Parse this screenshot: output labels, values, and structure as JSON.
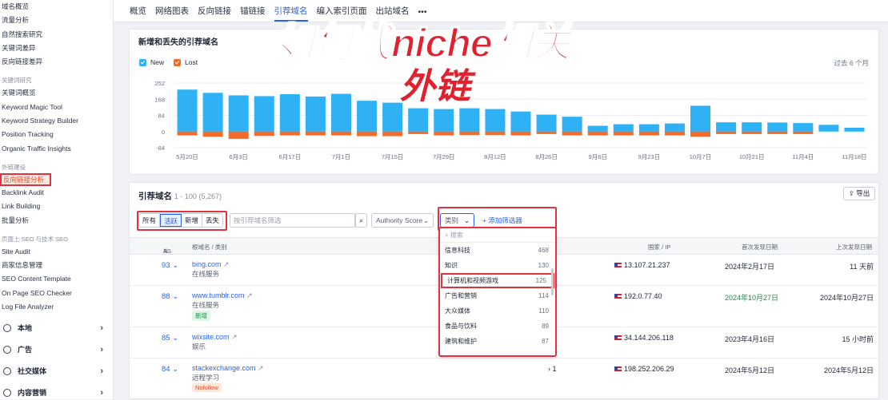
{
  "sidebar": {
    "top_items": [
      "域名概览",
      "流量分析",
      "自然搜索研究",
      "关键词差异",
      "反向链接差异"
    ],
    "section_keyword": "关键词研究",
    "keyword_items": [
      "关键词概览",
      "Keyword Magic Tool",
      "Keyword Strategy Builder",
      "Position Tracking",
      "Organic Traffic Insights"
    ],
    "section_link": "外链建设",
    "link_items": [
      "反向链接分析",
      "Backlink Audit",
      "Link Building",
      "批量分析"
    ],
    "section_seo": "页面上 SEO 与技术 SEO",
    "seo_items": [
      "Site Audit",
      "商家信息管理",
      "SEO Content Template",
      "On Page SEO Checker",
      "Log File Analyzer"
    ],
    "groups": [
      {
        "label": "本地",
        "icon": "location-icon"
      },
      {
        "label": "广告",
        "icon": "target-icon"
      },
      {
        "label": "社交媒体",
        "icon": "chat-icon"
      },
      {
        "label": "内容营销",
        "icon": "edit-icon"
      }
    ]
  },
  "topnav": {
    "tabs": [
      "概览",
      "网络图表",
      "反向链接",
      "锚链接",
      "引荐域名",
      "编入索引页面",
      "出站域名",
      "•••"
    ],
    "selected_index": 4
  },
  "chart_card": {
    "title": "新增和丢失的引荐域名",
    "legend_new": "New",
    "legend_lost": "Lost",
    "period": "过去 6 个月"
  },
  "chart_data": {
    "type": "bar",
    "series": [
      {
        "name": "New",
        "color": "#2fb2f5",
        "values": [
          218,
          201,
          188,
          184,
          194,
          182,
          196,
          160,
          150,
          121,
          117,
          121,
          117,
          104,
          88,
          77,
          30,
          38,
          38,
          42,
          134,
          48,
          48,
          47,
          44,
          35,
          20
        ]
      },
      {
        "name": "Lost",
        "color": "#f26b2b",
        "values": [
          -20,
          -27,
          -38,
          -23,
          -20,
          -20,
          -20,
          -24,
          -24,
          -13,
          -20,
          -18,
          -18,
          -20,
          -13,
          -20,
          -20,
          -20,
          -20,
          -20,
          -27,
          -13,
          -13,
          -13,
          -13,
          0,
          0
        ]
      }
    ],
    "x_tick_labels": [
      "5月20日",
      "6月3日",
      "6月17日",
      "7月1日",
      "7月15日",
      "7月29日",
      "8月12日",
      "8月26日",
      "9月6日",
      "9月23日",
      "10月7日",
      "10月21日",
      "11月4日",
      "11月18日"
    ],
    "y_ticks": [
      252,
      168,
      84,
      0,
      -84
    ],
    "ylim": [
      -84,
      252
    ]
  },
  "table_card": {
    "title": "引荐域名",
    "count": "1 - 100 (5,267)",
    "export_label": "导出",
    "segments": [
      "所有",
      "活跃",
      "新增",
      "丢失"
    ],
    "active_segment": 1,
    "search_placeholder": "按引荐域名筛选",
    "authority_label": "Authority Score",
    "category_label": "类别",
    "add_filter": "添加筛选器",
    "headers": {
      "as": "AS",
      "domain": "根域名 / 类别",
      "country": "国家 / IP",
      "first": "首次发现日期",
      "last": "上次发现日期"
    },
    "rows": [
      {
        "as": "93",
        "domain": "bing.com",
        "category": "在线服务",
        "badge": "",
        "links": "",
        "ip": "13.107.21.237",
        "first": "2024年2月17日",
        "last": "11 天前",
        "first_green": false
      },
      {
        "as": "88",
        "domain": "www.tumblr.com",
        "category": "在线服务",
        "badge": "新增",
        "links": "",
        "ip": "192.0.77.40",
        "first": "2024年10月27日",
        "last": "2024年10月27日",
        "first_green": true
      },
      {
        "as": "85",
        "domain": "wixsite.com",
        "category": "娱乐",
        "badge": "",
        "links": "",
        "ip": "34.144.206.118",
        "first": "2023年4月16日",
        "last": "15 小时前",
        "first_green": false
      },
      {
        "as": "84",
        "domain": "stackexchange.com",
        "category": "远程学习",
        "badge": "Nofollow",
        "links": "1",
        "ip": "198.252.206.29",
        "first": "2024年5月12日",
        "last": "2024年5月12日",
        "first_green": false
      }
    ],
    "dropdown": {
      "search_placeholder": "搜索",
      "options": [
        {
          "label": "信息科技",
          "count": "468"
        },
        {
          "label": "知识",
          "count": "130"
        },
        {
          "label": "计算机和视频游戏",
          "count": "125"
        },
        {
          "label": "广告和营销",
          "count": "114"
        },
        {
          "label": "大众媒体",
          "count": "110"
        },
        {
          "label": "食品与饮料",
          "count": "89"
        },
        {
          "label": "建筑和维护",
          "count": "87"
        }
      ],
      "highlighted_index": 2
    }
  },
  "overlay": {
    "line1": "如何找niche相关",
    "line2": "外链"
  }
}
